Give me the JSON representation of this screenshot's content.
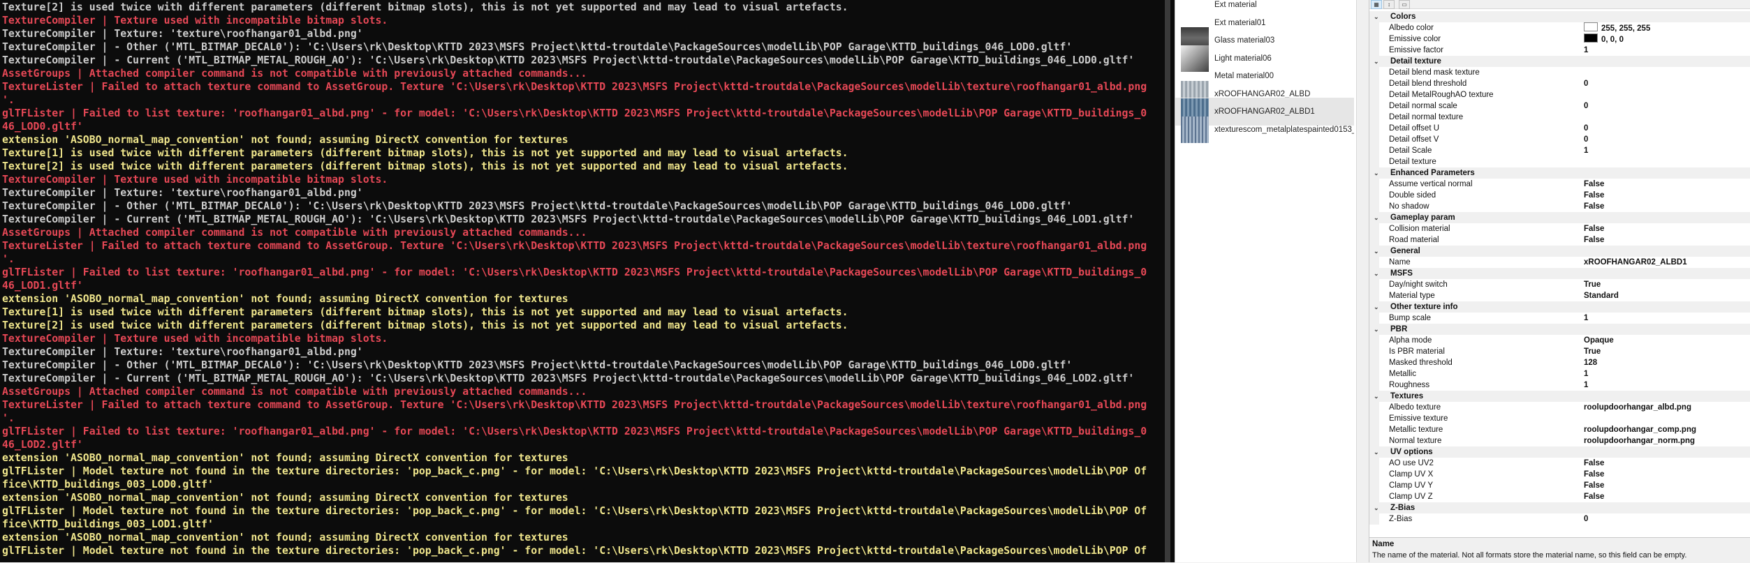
{
  "console": {
    "lines": [
      {
        "t": "Texture[2] is used twice with different parameters (different bitmap slots), this is not yet supported and may lead to visual artefacts.",
        "c": "white"
      },
      {
        "t": "TextureCompiler | Texture used with incompatible bitmap slots.",
        "c": "red"
      },
      {
        "t": "TextureCompiler | Texture: 'texture\\roofhangar01_albd.png'",
        "c": "white"
      },
      {
        "t": "TextureCompiler | - Other ('MTL_BITMAP_DECAL0'): 'C:\\Users\\rk\\Desktop\\KTTD 2023\\MSFS Project\\kttd-troutdale\\PackageSources\\modelLib\\POP Garage\\KTTD_buildings_046_LOD0.gltf'",
        "c": "white"
      },
      {
        "t": "TextureCompiler | - Current ('MTL_BITMAP_METAL_ROUGH_AO'): 'C:\\Users\\rk\\Desktop\\KTTD 2023\\MSFS Project\\kttd-troutdale\\PackageSources\\modelLib\\POP Garage\\KTTD_buildings_046_LOD0.gltf'",
        "c": "white"
      },
      {
        "t": "AssetGroups | Attached compiler command is not compatible with previously attached commands...",
        "c": "red"
      },
      {
        "t": "TextureLister | Failed to attach texture command to AssetGroup. Texture 'C:\\Users\\rk\\Desktop\\KTTD 2023\\MSFS Project\\kttd-troutdale\\PackageSources\\modelLib\\texture\\roofhangar01_albd.png",
        "c": "red"
      },
      {
        "t": "'.",
        "c": "red"
      },
      {
        "t": "glTFLister | Failed to list texture: 'roofhangar01_albd.png' - for model: 'C:\\Users\\rk\\Desktop\\KTTD 2023\\MSFS Project\\kttd-troutdale\\PackageSources\\modelLib\\POP Garage\\KTTD_buildings_0",
        "c": "red"
      },
      {
        "t": "46_LOD0.gltf'",
        "c": "red"
      },
      {
        "t": "extension 'ASOBO_normal_map_convention' not found; assuming DirectX convention for textures",
        "c": "yellow"
      },
      {
        "t": "Texture[1] is used twice with different parameters (different bitmap slots), this is not yet supported and may lead to visual artefacts.",
        "c": "yellow"
      },
      {
        "t": "Texture[2] is used twice with different parameters (different bitmap slots), this is not yet supported and may lead to visual artefacts.",
        "c": "yellow"
      },
      {
        "t": "TextureCompiler | Texture used with incompatible bitmap slots.",
        "c": "red"
      },
      {
        "t": "TextureCompiler | Texture: 'texture\\roofhangar01_albd.png'",
        "c": "white"
      },
      {
        "t": "TextureCompiler | - Other ('MTL_BITMAP_DECAL0'): 'C:\\Users\\rk\\Desktop\\KTTD 2023\\MSFS Project\\kttd-troutdale\\PackageSources\\modelLib\\POP Garage\\KTTD_buildings_046_LOD0.gltf'",
        "c": "white"
      },
      {
        "t": "TextureCompiler | - Current ('MTL_BITMAP_METAL_ROUGH_AO'): 'C:\\Users\\rk\\Desktop\\KTTD 2023\\MSFS Project\\kttd-troutdale\\PackageSources\\modelLib\\POP Garage\\KTTD_buildings_046_LOD1.gltf'",
        "c": "white"
      },
      {
        "t": "AssetGroups | Attached compiler command is not compatible with previously attached commands...",
        "c": "red"
      },
      {
        "t": "TextureLister | Failed to attach texture command to AssetGroup. Texture 'C:\\Users\\rk\\Desktop\\KTTD 2023\\MSFS Project\\kttd-troutdale\\PackageSources\\modelLib\\texture\\roofhangar01_albd.png",
        "c": "red"
      },
      {
        "t": "'.",
        "c": "red"
      },
      {
        "t": "glTFLister | Failed to list texture: 'roofhangar01_albd.png' - for model: 'C:\\Users\\rk\\Desktop\\KTTD 2023\\MSFS Project\\kttd-troutdale\\PackageSources\\modelLib\\POP Garage\\KTTD_buildings_0",
        "c": "red"
      },
      {
        "t": "46_LOD1.gltf'",
        "c": "red"
      },
      {
        "t": "extension 'ASOBO_normal_map_convention' not found; assuming DirectX convention for textures",
        "c": "yellow"
      },
      {
        "t": "Texture[1] is used twice with different parameters (different bitmap slots), this is not yet supported and may lead to visual artefacts.",
        "c": "yellow"
      },
      {
        "t": "Texture[2] is used twice with different parameters (different bitmap slots), this is not yet supported and may lead to visual artefacts.",
        "c": "yellow"
      },
      {
        "t": "TextureCompiler | Texture used with incompatible bitmap slots.",
        "c": "red"
      },
      {
        "t": "TextureCompiler | Texture: 'texture\\roofhangar01_albd.png'",
        "c": "white"
      },
      {
        "t": "TextureCompiler | - Other ('MTL_BITMAP_DECAL0'): 'C:\\Users\\rk\\Desktop\\KTTD 2023\\MSFS Project\\kttd-troutdale\\PackageSources\\modelLib\\POP Garage\\KTTD_buildings_046_LOD0.gltf'",
        "c": "white"
      },
      {
        "t": "TextureCompiler | - Current ('MTL_BITMAP_METAL_ROUGH_AO'): 'C:\\Users\\rk\\Desktop\\KTTD 2023\\MSFS Project\\kttd-troutdale\\PackageSources\\modelLib\\POP Garage\\KTTD_buildings_046_LOD2.gltf'",
        "c": "white"
      },
      {
        "t": "AssetGroups | Attached compiler command is not compatible with previously attached commands...",
        "c": "red"
      },
      {
        "t": "TextureLister | Failed to attach texture command to AssetGroup. Texture 'C:\\Users\\rk\\Desktop\\KTTD 2023\\MSFS Project\\kttd-troutdale\\PackageSources\\modelLib\\texture\\roofhangar01_albd.png",
        "c": "red"
      },
      {
        "t": "'.",
        "c": "red"
      },
      {
        "t": "glTFLister | Failed to list texture: 'roofhangar01_albd.png' - for model: 'C:\\Users\\rk\\Desktop\\KTTD 2023\\MSFS Project\\kttd-troutdale\\PackageSources\\modelLib\\POP Garage\\KTTD_buildings_0",
        "c": "red"
      },
      {
        "t": "46_LOD2.gltf'",
        "c": "red"
      },
      {
        "t": "extension 'ASOBO_normal_map_convention' not found; assuming DirectX convention for textures",
        "c": "yellow"
      },
      {
        "t": "glTFLister | Model texture not found in the texture directories: 'pop_back_c.png' - for model: 'C:\\Users\\rk\\Desktop\\KTTD 2023\\MSFS Project\\kttd-troutdale\\PackageSources\\modelLib\\POP Of",
        "c": "yellow"
      },
      {
        "t": "fice\\KTTD_buildings_003_LOD0.gltf'",
        "c": "yellow"
      },
      {
        "t": "extension 'ASOBO_normal_map_convention' not found; assuming DirectX convention for textures",
        "c": "yellow"
      },
      {
        "t": "glTFLister | Model texture not found in the texture directories: 'pop_back_c.png' - for model: 'C:\\Users\\rk\\Desktop\\KTTD 2023\\MSFS Project\\kttd-troutdale\\PackageSources\\modelLib\\POP Of",
        "c": "yellow"
      },
      {
        "t": "fice\\KTTD_buildings_003_LOD1.gltf'",
        "c": "yellow"
      },
      {
        "t": "extension 'ASOBO_normal_map_convention' not found; assuming DirectX convention for textures",
        "c": "yellow"
      },
      {
        "t": "glTFLister | Model texture not found in the texture directories: 'pop_back_c.png' - for model: 'C:\\Users\\rk\\Desktop\\KTTD 2023\\MSFS Project\\kttd-troutdale\\PackageSources\\modelLib\\POP Of",
        "c": "yellow"
      }
    ],
    "colors": {
      "white": "#cccccc",
      "yellow": "#f0e68c",
      "red": "#e74856"
    }
  },
  "materials": [
    {
      "label": "Ext material",
      "thumb": "blank",
      "selected": false
    },
    {
      "label": "Ext material01",
      "thumb": "blank",
      "selected": false
    },
    {
      "label": "Glass material03",
      "thumb": "glass",
      "selected": false
    },
    {
      "label": "Light material06",
      "thumb": "light",
      "selected": false
    },
    {
      "label": "Metal material00",
      "thumb": "blank",
      "selected": false
    },
    {
      "label": "xROOFHANGAR02_ALBD",
      "thumb": "metal",
      "selected": false
    },
    {
      "label": "xROOFHANGAR02_ALBD1",
      "thumb": "metal2",
      "selected": true
    },
    {
      "label": "xtexturescom_metalplatespainted0153_2...",
      "thumb": "metal3",
      "selected": false
    }
  ],
  "toolbar": {
    "categorized_icon": "categorized-icon",
    "alphabetical_icon": "alphabetical-icon",
    "pages_icon": "property-pages-icon"
  },
  "properties": [
    {
      "cat": "Colors",
      "rows": [
        {
          "n": "Albedo color",
          "v": "255, 255, 255",
          "swatch": "#ffffff"
        },
        {
          "n": "Emissive color",
          "v": "0, 0, 0",
          "swatch": "#000000"
        },
        {
          "n": "Emissive factor",
          "v": "1"
        }
      ]
    },
    {
      "cat": "Detail texture",
      "rows": [
        {
          "n": "Detail blend mask texture",
          "v": ""
        },
        {
          "n": "Detail blend threshold",
          "v": "0"
        },
        {
          "n": "Detail MetalRoughAO texture",
          "v": ""
        },
        {
          "n": "Detail normal scale",
          "v": "0"
        },
        {
          "n": "Detail normal texture",
          "v": ""
        },
        {
          "n": "Detail offset U",
          "v": "0"
        },
        {
          "n": "Detail offset V",
          "v": "0"
        },
        {
          "n": "Detail Scale",
          "v": "1"
        },
        {
          "n": "Detail texture",
          "v": ""
        }
      ]
    },
    {
      "cat": "Enhanced Parameters",
      "rows": [
        {
          "n": "Assume vertical normal",
          "v": "False"
        },
        {
          "n": "Double sided",
          "v": "False"
        },
        {
          "n": "No shadow",
          "v": "False"
        }
      ]
    },
    {
      "cat": "Gameplay param",
      "rows": [
        {
          "n": "Collision material",
          "v": "False"
        },
        {
          "n": "Road material",
          "v": "False"
        }
      ]
    },
    {
      "cat": "General",
      "rows": [
        {
          "n": "Name",
          "v": "xROOFHANGAR02_ALBD1"
        }
      ]
    },
    {
      "cat": "MSFS",
      "rows": [
        {
          "n": "Day/night switch",
          "v": "True"
        },
        {
          "n": "Material type",
          "v": "Standard"
        }
      ]
    },
    {
      "cat": "Other texture info",
      "rows": [
        {
          "n": "Bump scale",
          "v": "1"
        }
      ]
    },
    {
      "cat": "PBR",
      "rows": [
        {
          "n": "Alpha mode",
          "v": "Opaque"
        },
        {
          "n": "Is PBR material",
          "v": "True"
        },
        {
          "n": "Masked threshold",
          "v": "128"
        },
        {
          "n": "Metallic",
          "v": "1"
        },
        {
          "n": "Roughness",
          "v": "1"
        }
      ]
    },
    {
      "cat": "Textures",
      "rows": [
        {
          "n": "Albedo texture",
          "v": "roolupdoorhangar_albd.png"
        },
        {
          "n": "Emissive texture",
          "v": ""
        },
        {
          "n": "Metallic texture",
          "v": "roolupdoorhangar_comp.png"
        },
        {
          "n": "Normal texture",
          "v": "roolupdoorhangar_norm.png"
        }
      ]
    },
    {
      "cat": "UV options",
      "rows": [
        {
          "n": "AO use UV2",
          "v": "False"
        },
        {
          "n": "Clamp UV X",
          "v": "False"
        },
        {
          "n": "Clamp UV Y",
          "v": "False"
        },
        {
          "n": "Clamp UV Z",
          "v": "False"
        }
      ]
    },
    {
      "cat": "Z-Bias",
      "rows": [
        {
          "n": "Z-Bias",
          "v": "0"
        }
      ]
    }
  ],
  "description": {
    "title": "Name",
    "text": "The name of the material. Not all formats store the material name, so this field can be empty."
  }
}
